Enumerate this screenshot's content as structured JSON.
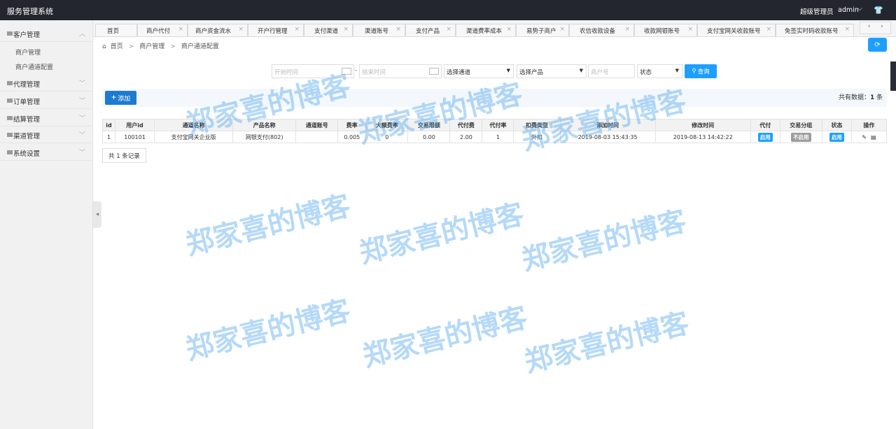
{
  "app": {
    "title": "服务管理系统",
    "user_role": "超级管理员",
    "username": "admin"
  },
  "sidebar": {
    "groups": [
      {
        "label": "客户管理",
        "items": [
          "商户管理",
          "商户通道配置"
        ]
      },
      {
        "label": "代理管理"
      },
      {
        "label": "订单管理"
      },
      {
        "label": "结算管理"
      },
      {
        "label": "渠道管理"
      },
      {
        "label": "系统设置"
      }
    ]
  },
  "tabs": [
    "首页",
    "商户代付",
    "商户资金流水",
    "开户行管理",
    "支付渠道",
    "渠道账号",
    "支付产品",
    "渠道费率成本",
    "易势子商户",
    "农信收款设备",
    "收款网银账号",
    "支付宝网关收款账号",
    "免签实时码收款账号"
  ],
  "tabnav": {
    "prev": "‹",
    "next": "›"
  },
  "breadcrumb": {
    "home": "首页",
    "level1": "商户管理",
    "level2": "商户通道配置"
  },
  "filters": {
    "start_placeholder": "开始时间",
    "dash": "-",
    "end_placeholder": "结束时间",
    "channel_select": "选择通道",
    "product_select": "选择产品",
    "merchant_placeholder": "商户号",
    "status_select": "状态",
    "query_label": "查询"
  },
  "toolbar": {
    "add_label": "添加",
    "total_label": "共有数据：",
    "total_value": "1",
    "total_unit": "条"
  },
  "table": {
    "headers": [
      "id",
      "用户id",
      "通道名称",
      "产品名称",
      "通道账号",
      "费率",
      "大额费率",
      "交易限额",
      "代付费",
      "代付率",
      "扣费类型",
      "添加时间",
      "修改时间",
      "代付",
      "交易分组",
      "状态",
      "操作"
    ],
    "rows": [
      {
        "id": "1",
        "user_id": "100101",
        "channel": "支付宝网关企业版",
        "product": "网银支付(802)",
        "account": "",
        "rate": "0.005",
        "large_rate": "0",
        "limit": "0.00",
        "payout_fee": "2.00",
        "payout_rate": "1",
        "deduct_type": "外扣",
        "created": "2019-08-03 15:43:35",
        "modified": "2019-08-13 14:42:22",
        "payout_badge": "启用",
        "group_badge": "不启用",
        "status_badge": "启用"
      }
    ]
  },
  "records": "共 1 条记录",
  "watermark": "郑家喜的博客",
  "colors": {
    "topbar": "#23262e",
    "primary": "#1e9fff",
    "badge_off": "#9c9c9c"
  }
}
